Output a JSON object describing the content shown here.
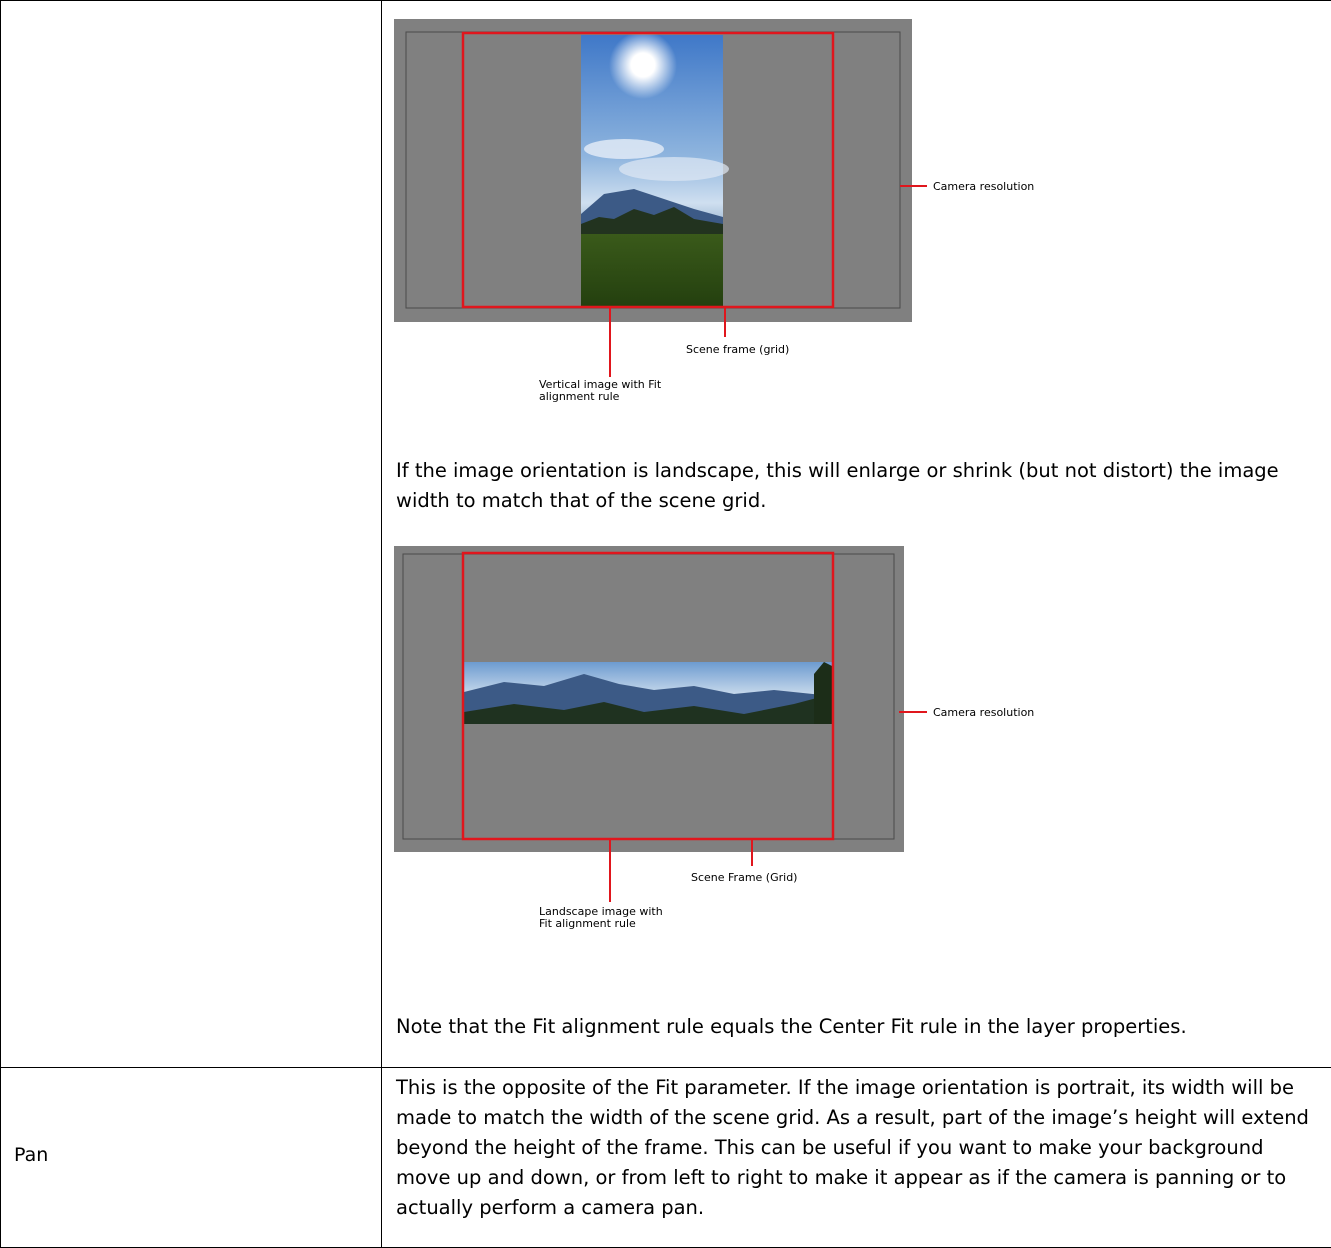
{
  "rows": [
    {
      "name": "",
      "figure1": {
        "callouts": {
          "camera": "Camera resolution",
          "scene": "Scene frame (grid)",
          "image_line1": "Vertical image with Fit",
          "image_line2": "alignment rule"
        }
      },
      "paragraph_landscape": "If the image orientation is landscape, this will enlarge or shrink (but not distort) the image width to match that of the scene grid.",
      "figure2": {
        "callouts": {
          "camera": "Camera resolution",
          "scene": "Scene Frame (Grid)",
          "image_line1": "Landscape image with",
          "image_line2": "Fit alignment rule"
        }
      },
      "note": "Note that the Fit alignment rule equals the Center Fit rule in the layer properties."
    },
    {
      "name": "Pan",
      "description": "This is the opposite of the Fit parameter. If the image orientation is portrait, its width will be made to match the width of the scene grid. As a result, part of the image’s height will extend beyond the height of the frame. This can be useful if you want to make your background move up and down, or from left to right to make it appear as if the camera is panning or to actually perform a camera pan."
    }
  ],
  "colors": {
    "frame_red": "#e0161d",
    "camera_gray": "#808080"
  }
}
